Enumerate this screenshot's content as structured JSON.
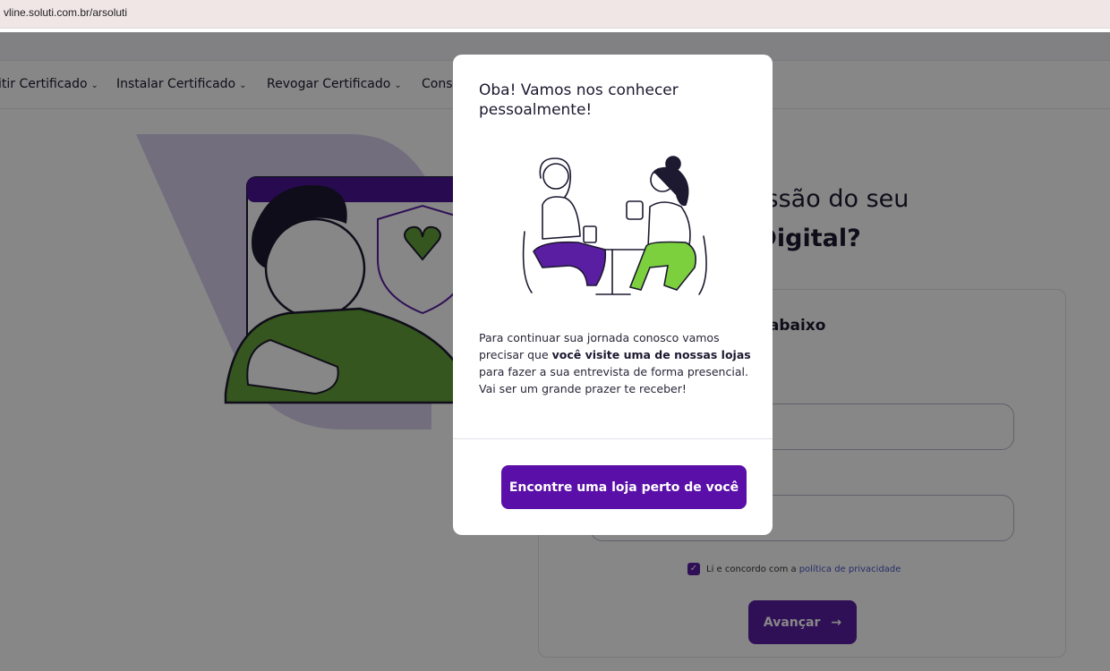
{
  "browser": {
    "url": "vline.soluti.com.br/arsoluti"
  },
  "nav": {
    "items": [
      {
        "label": "itir Certificado"
      },
      {
        "label": "Instalar Certificado"
      },
      {
        "label": "Revogar Certificado"
      },
      {
        "label": "Cons"
      }
    ]
  },
  "hero": {
    "title_line1": "a emissão do seu",
    "title_line2": "ado Digital?"
  },
  "form": {
    "heading": "os campos abaixo",
    "consent_text": "Li e concordo com a",
    "consent_link": "política de privacidade",
    "submit_label": "Avançar"
  },
  "modal": {
    "title": "Oba! Vamos nos conhecer pessoalmente!",
    "text_before_bold": "Para continuar sua jornada conosco vamos precisar que ",
    "text_bold": "você visite uma de nossas lojas",
    "text_after_bold": " para fazer a sua entrevista de forma presencial.",
    "text_closing": "Vai ser um grande prazer te receber!",
    "cta_label": "Encontre uma loja perto de você"
  },
  "colors": {
    "primary": "#5a1ea3",
    "modal_button": "#5a0fa8",
    "accent_green": "#67a33b",
    "link": "#4a55c8"
  }
}
